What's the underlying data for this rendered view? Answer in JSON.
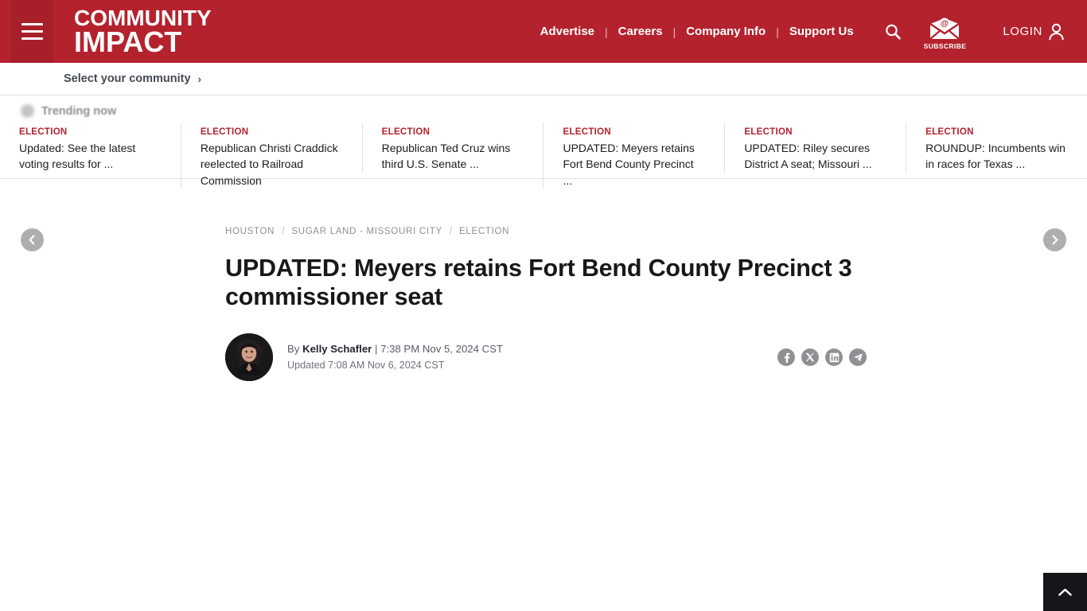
{
  "header": {
    "menu_icon": "hamburger-icon",
    "logo_line1": "COMMUNITY",
    "logo_line2": "IMPACT",
    "nav": [
      {
        "label": "Advertise"
      },
      {
        "label": "Careers"
      },
      {
        "label": "Company Info"
      },
      {
        "label": "Support Us"
      }
    ],
    "nav_separator": "|",
    "search_icon": "search-icon",
    "subscribe_icon": "envelope-at-icon",
    "subscribe_label": "SUBSCRIBE",
    "login_label": "LOGIN",
    "login_icon": "user-icon",
    "brand_color": "#b4222e"
  },
  "community_bar": {
    "label": "Select your community",
    "chevron": "›"
  },
  "trending": {
    "label": "Trending now",
    "prev_icon": "chevron-left-icon",
    "next_icon": "chevron-right-icon",
    "cards": [
      {
        "category": "ELECTION",
        "title": "Updated: See the latest voting results for ..."
      },
      {
        "category": "ELECTION",
        "title": "Republican Christi Craddick reelected to Railroad Commission"
      },
      {
        "category": "ELECTION",
        "title": "Republican Ted Cruz wins third U.S. Senate ..."
      },
      {
        "category": "ELECTION",
        "title": "UPDATED: Meyers retains Fort Bend County Precinct ..."
      },
      {
        "category": "ELECTION",
        "title": "UPDATED: Riley secures District A seat; Missouri ..."
      },
      {
        "category": "ELECTION",
        "title": "ROUNDUP: Incumbents win in races for Texas ..."
      }
    ]
  },
  "article": {
    "breadcrumb": [
      {
        "label": "HOUSTON"
      },
      {
        "label": "SUGAR LAND - MISSOURI CITY"
      },
      {
        "label": "ELECTION"
      }
    ],
    "breadcrumb_separator": "/",
    "headline": "UPDATED: Meyers retains Fort Bend County Precinct 3 commissioner seat",
    "byline_prefix": "By",
    "author": "Kelly Schafler",
    "byline_divider": "|",
    "published": "7:38 PM Nov 5, 2024 CST",
    "updated": "Updated 7:08 AM Nov 6, 2024 CST",
    "avatar_alt": "author-portrait",
    "share": [
      {
        "name": "facebook-icon"
      },
      {
        "name": "x-twitter-icon"
      },
      {
        "name": "linkedin-icon"
      },
      {
        "name": "share-send-icon"
      }
    ]
  },
  "back_to_top": {
    "icon": "chevron-up-icon"
  }
}
